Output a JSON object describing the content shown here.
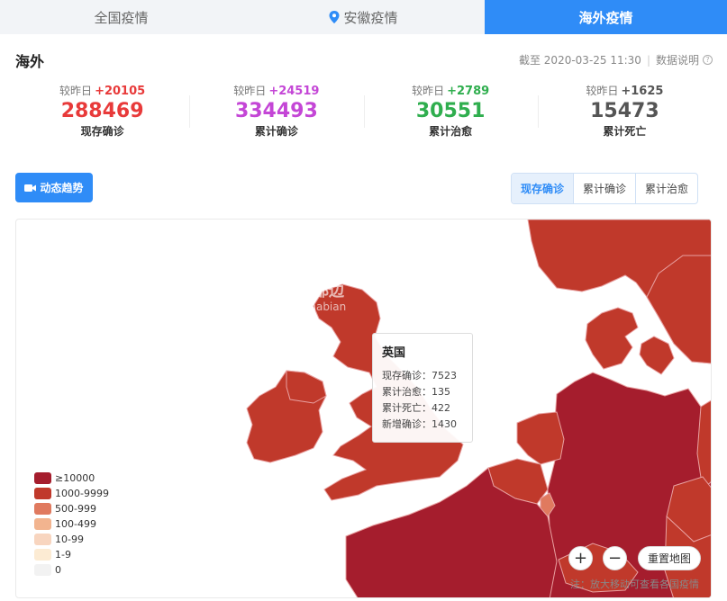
{
  "tabs": [
    {
      "label": "全国疫情",
      "active": false
    },
    {
      "label": "安徽疫情",
      "active": false,
      "icon": "location-pin-icon"
    },
    {
      "label": "海外疫情",
      "active": true
    }
  ],
  "header": {
    "title": "海外",
    "as_of": "截至 2020-03-25 11:30",
    "data_note": "数据说明",
    "help_icon": "?"
  },
  "stats": [
    {
      "compare_label": "较昨日",
      "delta": "+20105",
      "value": "288469",
      "label": "现存确诊",
      "color": "#e83a3a"
    },
    {
      "compare_label": "较昨日",
      "delta": "+24519",
      "value": "334493",
      "label": "累计确诊",
      "color": "#c446d6"
    },
    {
      "compare_label": "较昨日",
      "delta": "+2789",
      "value": "30551",
      "label": "累计治愈",
      "color": "#2fae4e"
    },
    {
      "compare_label": "较昨日",
      "delta": "+1625",
      "value": "15473",
      "label": "累计死亡",
      "color": "#555555"
    }
  ],
  "trend_button": {
    "label": "动态趋势",
    "icon": "video-camera-icon"
  },
  "segments": [
    "现存确诊",
    "累计确诊",
    "累计治愈"
  ],
  "watermark": {
    "line1": "海都边",
    "line2": "Hinabian"
  },
  "tooltip": {
    "title": "英国",
    "rows": [
      "现存确诊：7523",
      "累计治愈：135",
      "累计死亡：422",
      "新增确诊：1430"
    ]
  },
  "legend": [
    {
      "label": "≥10000",
      "color": "#a51d2d"
    },
    {
      "label": "1000-9999",
      "color": "#c0392b"
    },
    {
      "label": "500-999",
      "color": "#e07a5f"
    },
    {
      "label": "100-499",
      "color": "#f2b48f"
    },
    {
      "label": "10-99",
      "color": "#f8d5bf"
    },
    {
      "label": "1-9",
      "color": "#fcebd3"
    },
    {
      "label": "0",
      "color": "#f2f2f2"
    }
  ],
  "controls": {
    "zoom_in": "+",
    "zoom_out": "−",
    "reset": "重置地图"
  },
  "note": "注：放大移动可查看各国疫情"
}
